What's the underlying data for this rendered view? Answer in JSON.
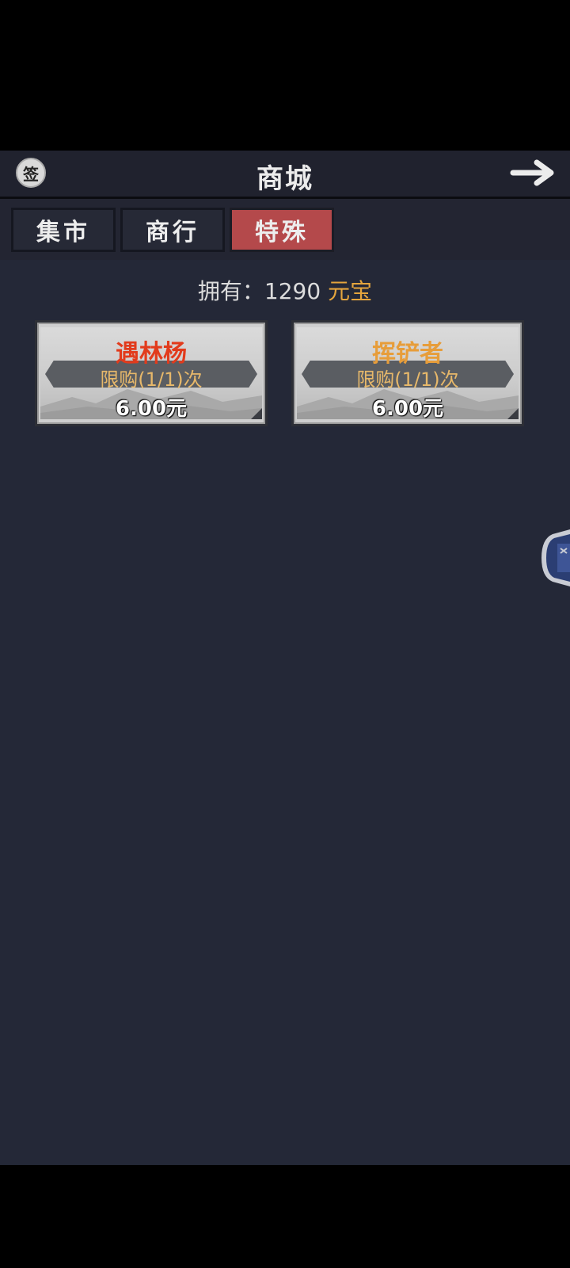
{
  "header": {
    "sign_icon_label": "签",
    "title": "商城",
    "back_icon": "arrow-right-icon"
  },
  "tabs": [
    {
      "label": "集市",
      "active": false
    },
    {
      "label": "商行",
      "active": false
    },
    {
      "label": "特殊",
      "active": true
    }
  ],
  "balance": {
    "prefix": "拥有：",
    "amount": "1290",
    "currency": "元宝"
  },
  "items": [
    {
      "name": "遇林杨",
      "name_color": "#e23b1c",
      "limit": "限购(1/1)次",
      "price": "6.00元"
    },
    {
      "name": "挥铲者",
      "name_color": "#e79d3a",
      "limit": "限购(1/1)次",
      "price": "6.00元"
    }
  ],
  "colors": {
    "background": "#242837",
    "active_tab": "#b4494b",
    "currency": "#e5a53d"
  }
}
